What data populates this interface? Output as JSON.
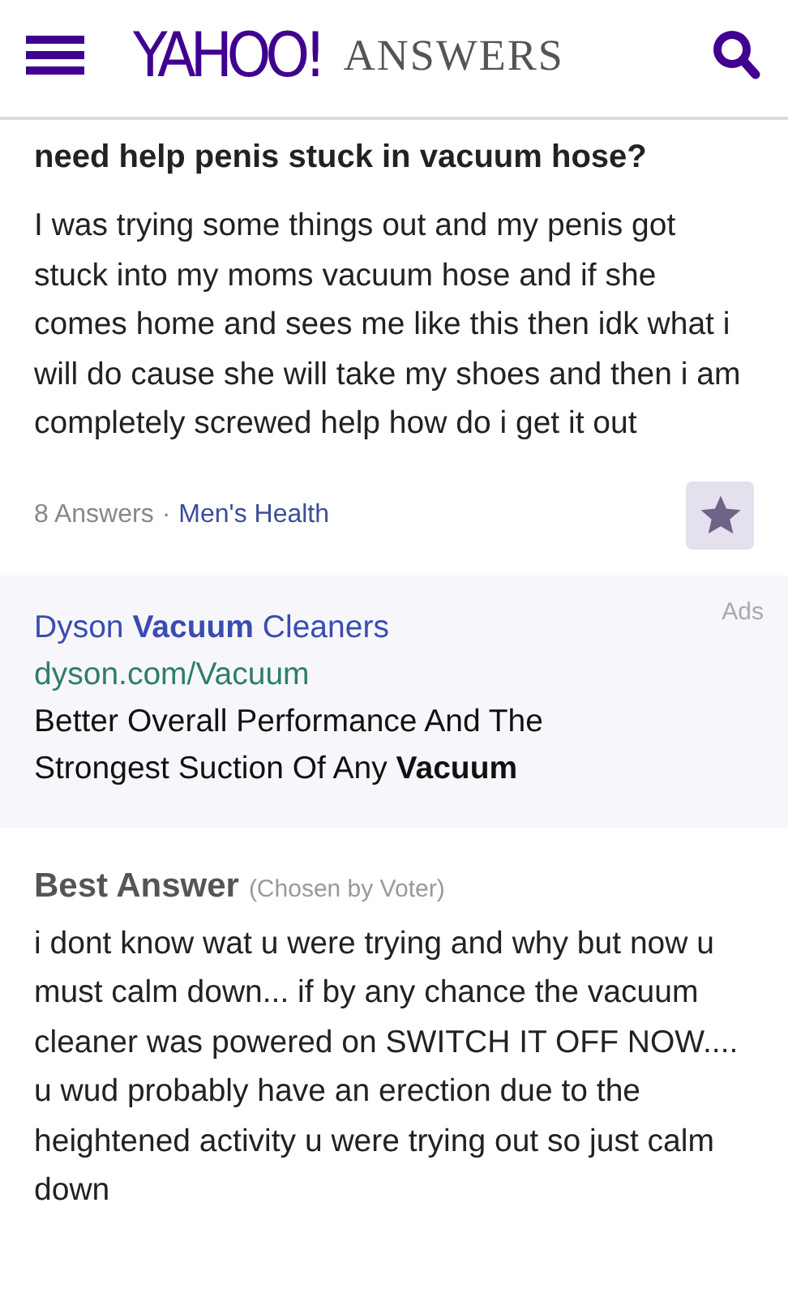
{
  "header": {
    "logo": "YAHOO!",
    "section": "ANSWERS"
  },
  "question": {
    "title": "need help penis stuck in vacuum hose?",
    "body": "I was trying some things out and my penis got stuck into my moms vacuum hose and if she comes home and sees me like this then idk what i will do cause she will take my shoes and then i am completely screwed help how do i get it out",
    "answer_count": "8 Answers",
    "separator": "·",
    "category": "Men's Health"
  },
  "ad": {
    "label": "Ads",
    "title": "Dyson **Vacuum** Cleaners",
    "url": "dyson.com/Vacuum",
    "text": "Better Overall Performance And The Strongest Suction Of Any **Vacuum**"
  },
  "best_answer": {
    "heading": "Best Answer",
    "note": "(Chosen by Voter)",
    "body": "i dont know wat u were trying and why but now u must calm down... if by any chance the vacuum cleaner was powered on SWITCH IT OFF NOW.... u wud probably have an erection due to the heightened activity u were trying out so just calm down"
  }
}
